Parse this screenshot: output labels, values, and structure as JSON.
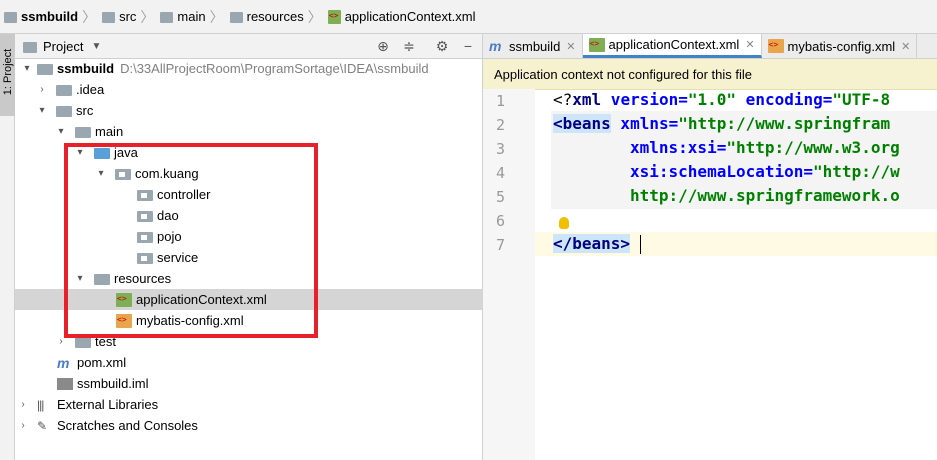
{
  "breadcrumb": {
    "items": [
      "ssmbuild",
      "src",
      "main",
      "resources",
      "applicationContext.xml"
    ]
  },
  "left_strip": {
    "tab_label": "1: Project"
  },
  "project_panel": {
    "title": "Project",
    "tree": [
      {
        "label": "ssmbuild",
        "path": "D:\\33AllProjectRoom\\ProgramSortage\\IDEA\\ssmbuild"
      },
      {
        "label": ".idea"
      },
      {
        "label": "src"
      },
      {
        "label": "main"
      },
      {
        "label": "java"
      },
      {
        "label": "com.kuang"
      },
      {
        "label": "controller"
      },
      {
        "label": "dao"
      },
      {
        "label": "pojo"
      },
      {
        "label": "service"
      },
      {
        "label": "resources"
      },
      {
        "label": "applicationContext.xml"
      },
      {
        "label": "mybatis-config.xml"
      },
      {
        "label": "test"
      },
      {
        "label": "pom.xml"
      },
      {
        "label": "ssmbuild.iml"
      },
      {
        "label": "External Libraries"
      },
      {
        "label": "Scratches and Consoles"
      }
    ],
    "selected_item": "applicationContext.xml"
  },
  "editor": {
    "tabs": [
      {
        "label": "ssmbuild",
        "icon": "maven-icon"
      },
      {
        "label": "applicationContext.xml",
        "icon": "spring-xml-icon",
        "active": true
      },
      {
        "label": "mybatis-config.xml",
        "icon": "xml-icon"
      }
    ],
    "banner": "Application context not configured for this file",
    "line_numbers": [
      "1",
      "2",
      "3",
      "4",
      "5",
      "6",
      "7"
    ],
    "code": {
      "l1_a": "<?",
      "l1_b": "xml",
      "l1_c": " version=",
      "l1_d": "\"1.0\"",
      "l1_e": " encoding=",
      "l1_f": "\"UTF-8",
      "l2_tag": "<beans",
      "l2_attr": " xmlns=",
      "l2_val": "\"http://www.springfram",
      "l3_attr": "xmlns:xsi=",
      "l3_val": "\"http://www.w3.org",
      "l4_attr": "xsi:schemaLocation=",
      "l4_val": "\"http://w",
      "l5_val": "http://www.springframework.o",
      "l7_tag": "</beans>"
    }
  },
  "colors": {
    "highlight_box": "#e8202a",
    "selection": "#d5d5d5",
    "banner_bg": "#f6f2d0"
  }
}
